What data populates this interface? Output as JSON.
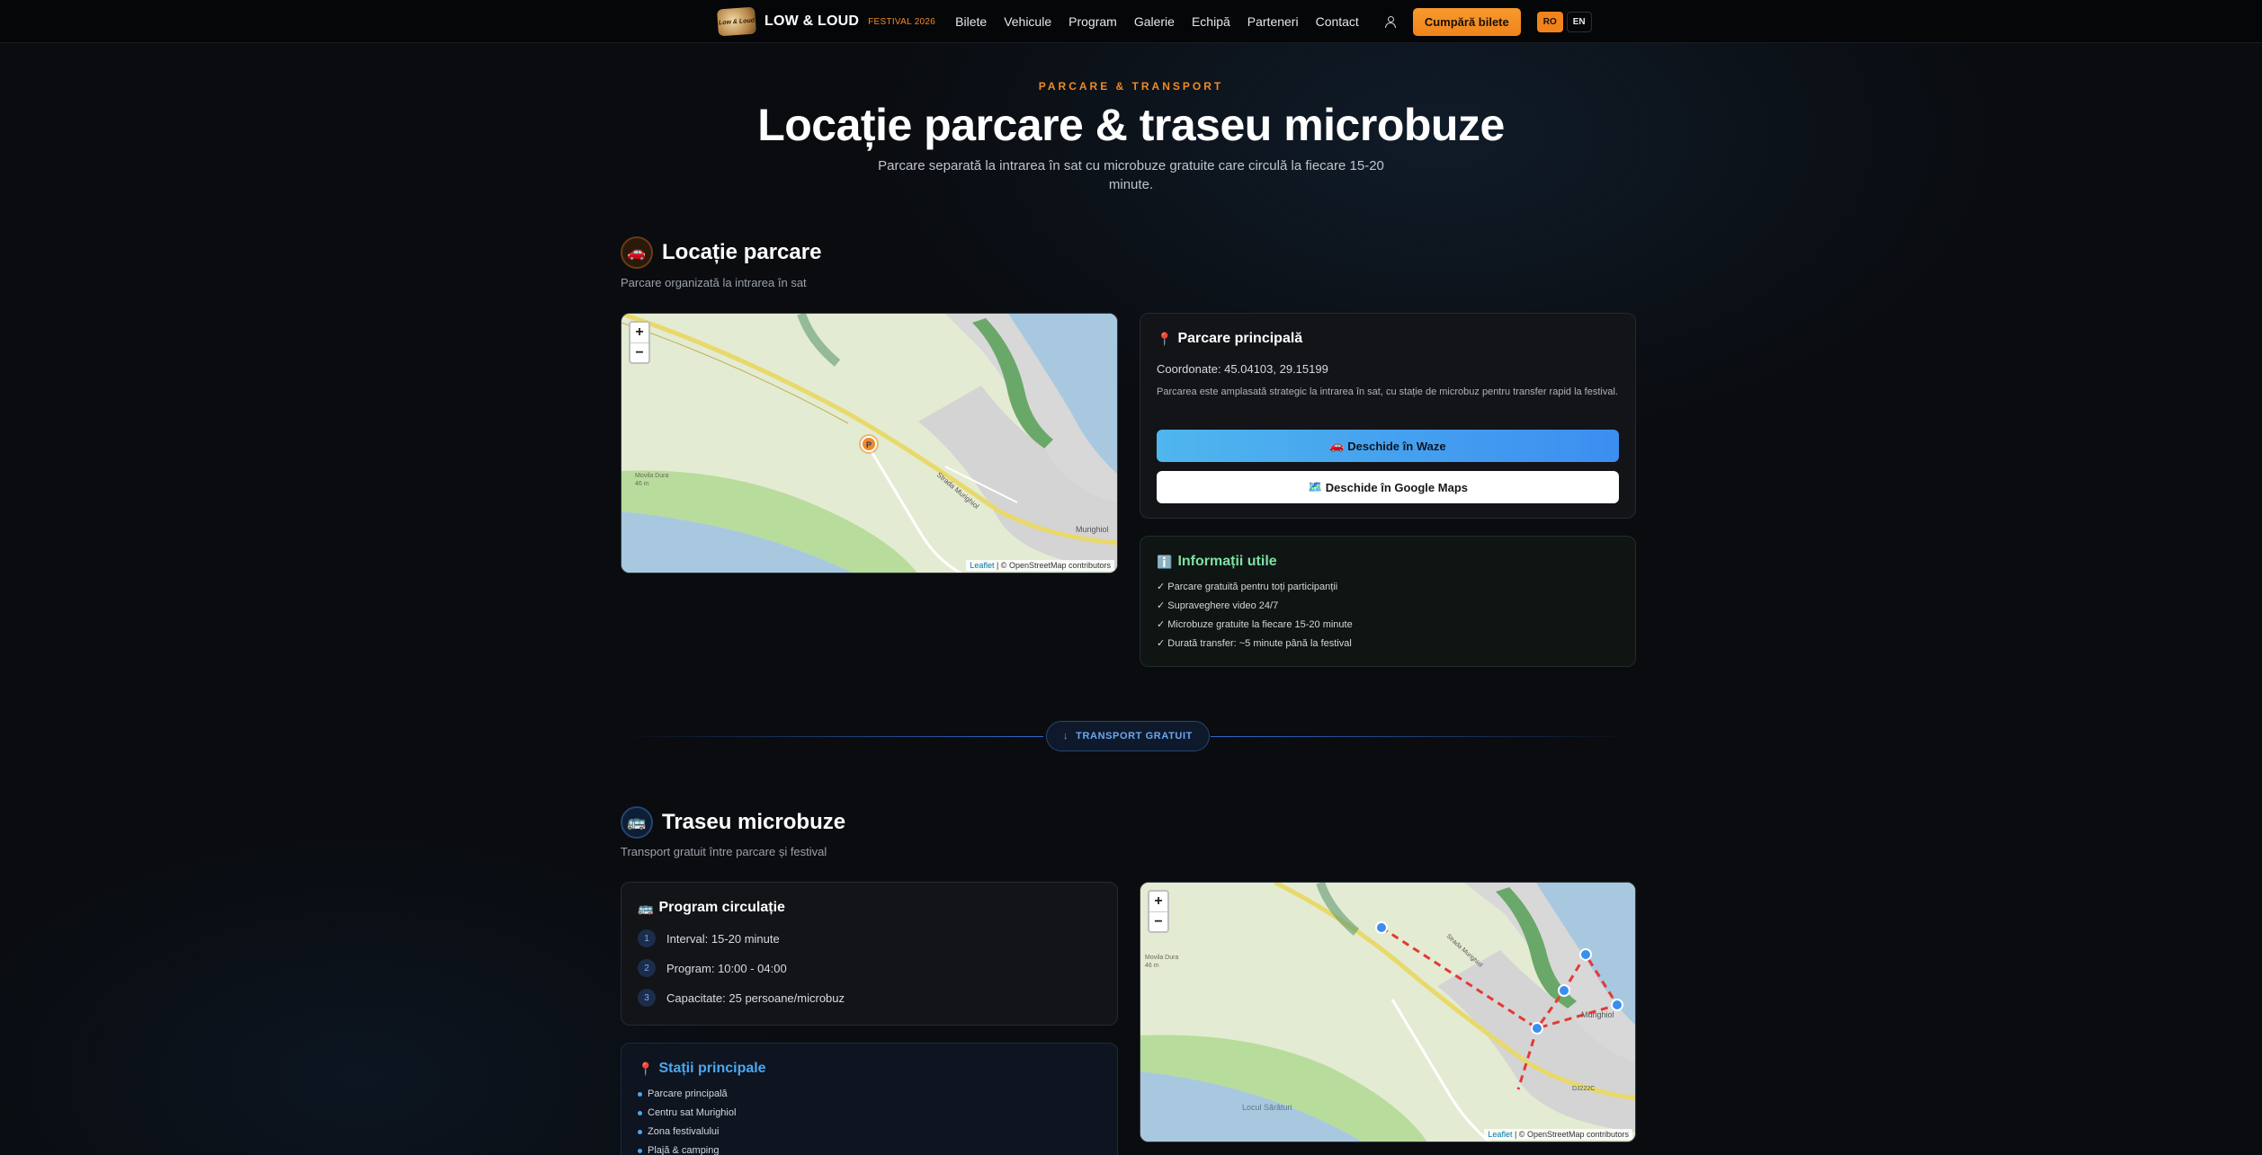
{
  "nav": {
    "logo_text": "Low & Loud",
    "brand": "LOW & LOUD",
    "brand_sub": "FESTIVAL 2026",
    "links": [
      "Bilete",
      "Vehicule",
      "Program",
      "Galerie",
      "Echipă",
      "Parteneri",
      "Contact"
    ],
    "buy_label": "Cumpără bilete",
    "lang": [
      "RO",
      "EN"
    ],
    "active_lang": "RO"
  },
  "hero": {
    "eyebrow": "PARCARE & TRANSPORT",
    "title": "Locație parcare & traseu microbuze",
    "subtitle": "Parcare separată la intrarea în sat cu microbuze gratuite care circulă la fiecare 15-20 minute."
  },
  "parking": {
    "icon": "car-icon",
    "title": "Locație parcare",
    "subtitle": "Parcare organizată la intrarea în sat",
    "map": {
      "zoom_in": "+",
      "zoom_out": "−",
      "marker_label": "P",
      "attrib_leaflet": "Leaflet",
      "attrib_osm": "| © OpenStreetMap contributors",
      "labels": {
        "hill": "Movila Dura",
        "hill_elev": "46 m",
        "road": "Strada Murighiol",
        "town": "Murighiol"
      }
    },
    "main": {
      "icon": "pin-icon",
      "title": "Parcare principală",
      "coords": "Coordonate: 45.04103, 29.15199",
      "description": "Parcarea este amplasată strategic la intrarea în sat, cu stație de microbuz pentru transfer rapid la festival.",
      "waze_label": "Deschide în Waze",
      "gmaps_label": "Deschide în Google Maps"
    },
    "info": {
      "icon": "info-icon",
      "title": "Informații utile",
      "items": [
        "✓ Parcare gratuită pentru toți participanții",
        "✓ Supraveghere video 24/7",
        "✓ Microbuze gratuite la fiecare 15-20 minute",
        "✓ Durată transfer: ~5 minute până la festival"
      ]
    }
  },
  "divider": {
    "label": "TRANSPORT GRATUIT"
  },
  "shuttle": {
    "icon": "bus-icon",
    "title": "Traseu microbuze",
    "subtitle": "Transport gratuit între parcare și festival",
    "schedule": {
      "title": "Program circulație",
      "items": [
        {
          "num": "1",
          "text": "Interval: 15-20 minute"
        },
        {
          "num": "2",
          "text": "Program: 10:00 - 04:00"
        },
        {
          "num": "3",
          "text": "Capacitate: 25 persoane/microbuz"
        }
      ]
    },
    "stations": {
      "title": "Stații principale",
      "items": [
        "Parcare principală",
        "Centru sat Murighiol",
        "Zona festivalului",
        "Plajă & camping"
      ]
    },
    "map": {
      "zoom_in": "+",
      "zoom_out": "−",
      "attrib_leaflet": "Leaflet",
      "attrib_osm": "| © OpenStreetMap contributors",
      "labels": {
        "hill": "Movila Dura",
        "hill_elev": "46 m",
        "lake": "Locul Sărături",
        "town": "Murighiol",
        "road_code": "DJ222C",
        "road": "Strada Murighiol"
      }
    }
  }
}
